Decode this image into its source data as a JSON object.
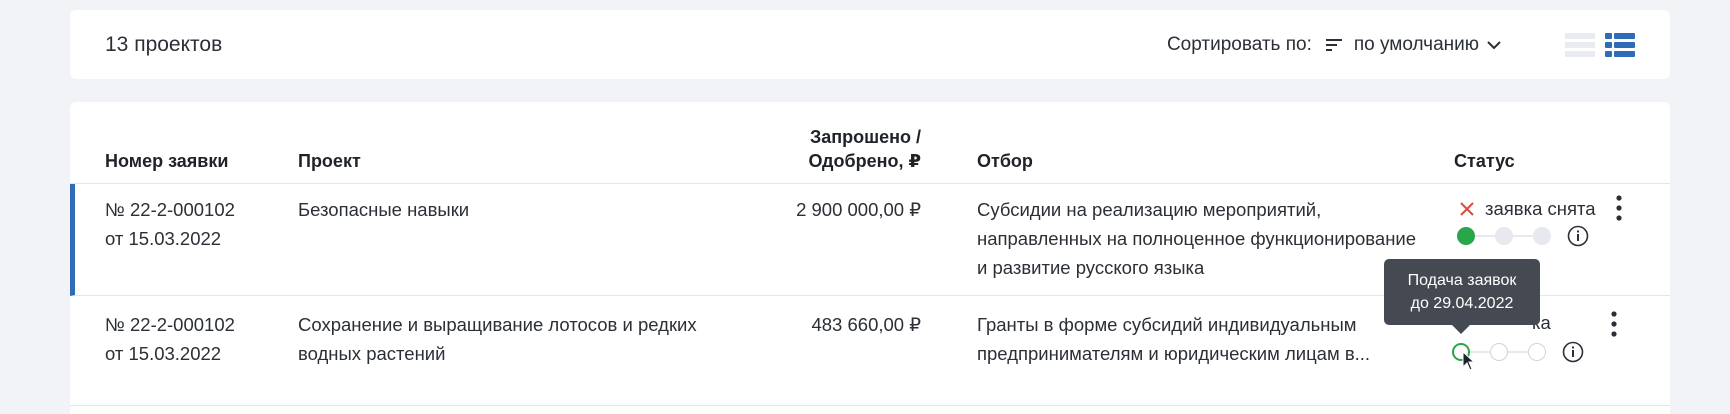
{
  "toolbar": {
    "count_label": "13 проектов",
    "sort_label": "Сортировать по:",
    "sort_value": "по умолчанию",
    "icons": [
      "sort-lines-icon",
      "chevron-down-icon",
      "list-view-icon",
      "table-view-icon"
    ]
  },
  "table": {
    "headers": {
      "number": "Номер заявки",
      "project": "Проект",
      "amount_line1": "Запрошено /",
      "amount_line2": "Одобрено, ₽",
      "selection": "Отбор",
      "status": "Статус"
    },
    "rows": [
      {
        "number_line1": "№ 22-2-000102",
        "number_line2": "от 15.03.2022",
        "project_line1": "Безопасные навыки",
        "project_line2": "",
        "amount": "2 900 000,00 ₽",
        "selection_line1": "Субсидии на реализацию мероприятий,",
        "selection_line2": "направленных на полноценное функционирование",
        "selection_line3": "и развитие русского языка",
        "status": "заявка снята",
        "status_icon": "close-x-icon",
        "status_color": "#e04b3a"
      },
      {
        "number_line1": "№ 22-2-000102",
        "number_line2": "от 15.03.2022",
        "project_line1": "Сохранение и выращивание лотосов и редких",
        "project_line2": "водных растений",
        "amount": "483 660,00 ₽",
        "selection_line1": "Гранты в форме субсидий индивидуальным",
        "selection_line2": "предпринимателям и юридическим лицам в...",
        "status_visible_fragment": "ка"
      }
    ]
  },
  "tooltip": {
    "line1": "Подача заявок",
    "line2": "до 29.04.2022"
  },
  "colors": {
    "accent": "#2f6bb8",
    "success": "#27a74a",
    "danger": "#e04b3a",
    "tooltip_bg": "#454a52"
  }
}
